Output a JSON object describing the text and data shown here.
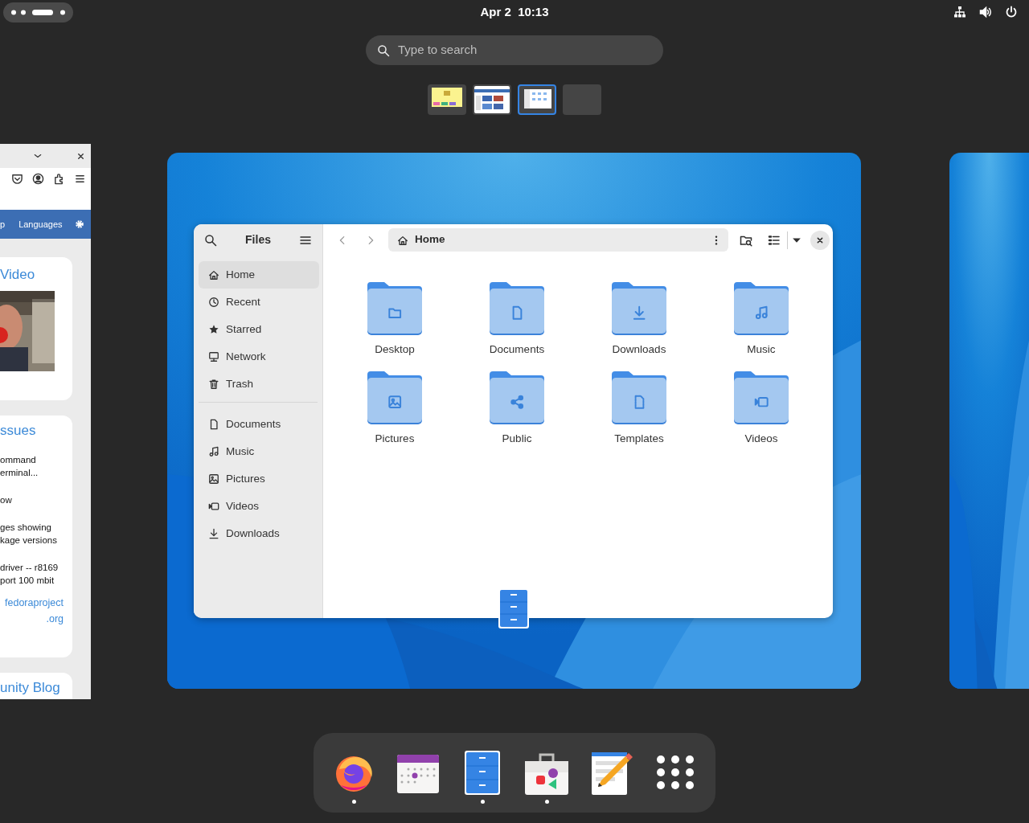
{
  "top_bar": {
    "clock": "Apr 2  10:13"
  },
  "search": {
    "placeholder": "Type to search"
  },
  "workspaces": [
    {
      "kind": "yellow-app",
      "selected": false
    },
    {
      "kind": "web-page",
      "selected": false
    },
    {
      "kind": "files",
      "selected": true
    },
    {
      "kind": "empty",
      "selected": false
    }
  ],
  "browser_window": {
    "nav_items": [
      "p",
      "Languages"
    ],
    "cards": [
      {
        "kind": "video",
        "title": "Video"
      },
      {
        "kind": "list",
        "title": "ssues",
        "items": [
          [
            "ommand",
            "erminal..."
          ],
          [
            "ow"
          ],
          [
            "ges showing",
            "kage versions"
          ],
          [
            "driver -- r8169",
            "port 100 mbit"
          ]
        ],
        "link": [
          "fedoraproject",
          ".org"
        ]
      },
      {
        "kind": "title",
        "title": "unity Blog"
      }
    ]
  },
  "files_window": {
    "title": "Files",
    "path": "Home",
    "places": [
      {
        "kind": "home",
        "label": "Home",
        "selected": true
      },
      {
        "kind": "recent",
        "label": "Recent",
        "selected": false
      },
      {
        "kind": "starred",
        "label": "Starred",
        "selected": false
      },
      {
        "kind": "network",
        "label": "Network",
        "selected": false
      },
      {
        "kind": "trash",
        "label": "Trash",
        "selected": false
      }
    ],
    "bookmarks": [
      {
        "kind": "documents",
        "label": "Documents",
        "selected": false
      },
      {
        "kind": "music",
        "label": "Music",
        "selected": false
      },
      {
        "kind": "pictures",
        "label": "Pictures",
        "selected": false
      },
      {
        "kind": "videos",
        "label": "Videos",
        "selected": false
      },
      {
        "kind": "downloads",
        "label": "Downloads",
        "selected": false
      }
    ],
    "folders": [
      {
        "kind": "desktop",
        "name": "Desktop"
      },
      {
        "kind": "documents",
        "name": "Documents"
      },
      {
        "kind": "downloads",
        "name": "Downloads"
      },
      {
        "kind": "music",
        "name": "Music"
      },
      {
        "kind": "pictures",
        "name": "Pictures"
      },
      {
        "kind": "public",
        "name": "Public"
      },
      {
        "kind": "templates",
        "name": "Templates"
      },
      {
        "kind": "videos",
        "name": "Videos"
      }
    ]
  },
  "dock": [
    {
      "kind": "browser",
      "running": true
    },
    {
      "kind": "calendar",
      "running": false
    },
    {
      "kind": "files",
      "running": true
    },
    {
      "kind": "software",
      "running": true
    },
    {
      "kind": "editor",
      "running": false
    },
    {
      "kind": "app-grid",
      "running": false
    }
  ]
}
